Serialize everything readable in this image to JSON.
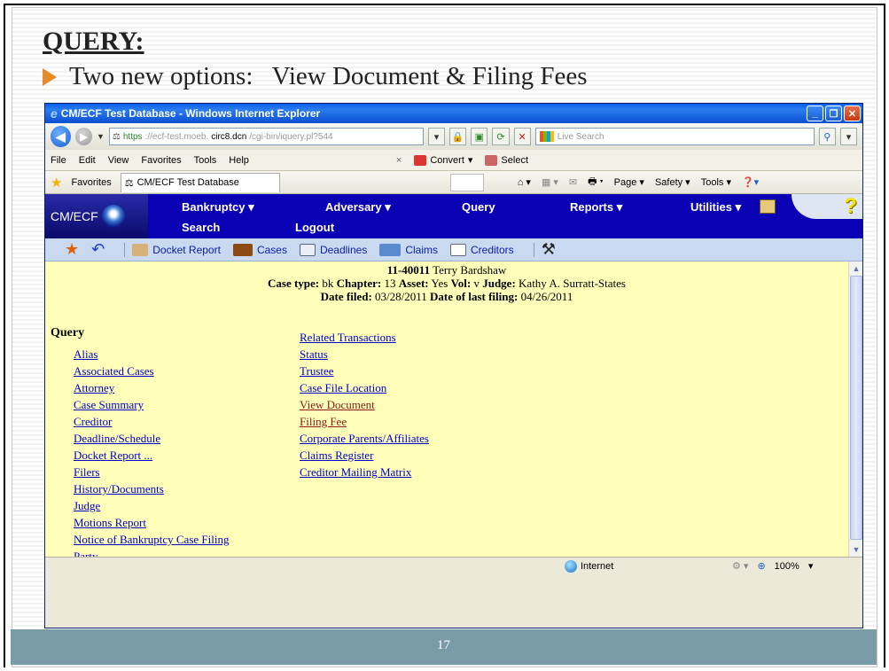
{
  "slide": {
    "title": "QUERY:",
    "bullet": "Two new options:   View Document & Filing Fees",
    "page_number": "17"
  },
  "browser": {
    "window_title": "CM/ECF Test Database - Windows Internet Explorer",
    "url_scheme": "https",
    "url_host_dim": "://ecf-test.moeb.",
    "url_host": "circ8.dcn",
    "url_path": "/cgi-bin/iquery.pl?544",
    "search_placeholder": "Live Search",
    "menu": [
      "File",
      "Edit",
      "View",
      "Favorites",
      "Tools",
      "Help"
    ],
    "menu_x": "×",
    "convert_label": "Convert",
    "select_label": "Select",
    "favorites_label": "Favorites",
    "tab_title": "CM/ECF Test Database",
    "commands": [
      "Page",
      "Safety",
      "Tools"
    ],
    "status_zone": "Internet",
    "zoom": "100%"
  },
  "ecf": {
    "logo": "CM/ECF",
    "nav": {
      "bankruptcy": "Bankruptcy ▾",
      "adversary": "Adversary ▾",
      "query": "Query",
      "reports": "Reports ▾",
      "utilities": "Utilities ▾",
      "search": "Search",
      "logout": "Logout"
    },
    "toolbar": {
      "docket_report": "Docket Report",
      "cases": "Cases",
      "deadlines": "Deadlines",
      "claims": "Claims",
      "creditors": "Creditors"
    },
    "case": {
      "number": "11-40011",
      "debtor": "Terry Bardshaw",
      "case_type_label": "Case type:",
      "case_type": "bk",
      "chapter_label": "Chapter:",
      "chapter": "13",
      "asset_label": "Asset:",
      "asset": "Yes",
      "vol_label": "Vol:",
      "vol": "v",
      "judge_label": "Judge:",
      "judge": "Kathy A. Surratt-States",
      "date_filed_label": "Date filed:",
      "date_filed": "03/28/2011",
      "last_filing_label": "Date of last filing:",
      "last_filing": "04/26/2011"
    },
    "query_heading": "Query",
    "links_col1": [
      "Alias",
      "Associated Cases",
      "Attorney",
      "Case Summary",
      "Creditor",
      "Deadline/Schedule",
      "Docket Report ...",
      "Filers",
      "History/Documents",
      "Judge",
      "Motions Report",
      "Notice of Bankruptcy Case Filing",
      "Party"
    ],
    "links_col2": [
      "Related Transactions",
      "Status",
      "Trustee",
      "Case File Location",
      "View Document",
      "Filing Fee",
      "Corporate Parents/Affiliates",
      "Claims Register",
      "Creditor Mailing Matrix"
    ]
  }
}
